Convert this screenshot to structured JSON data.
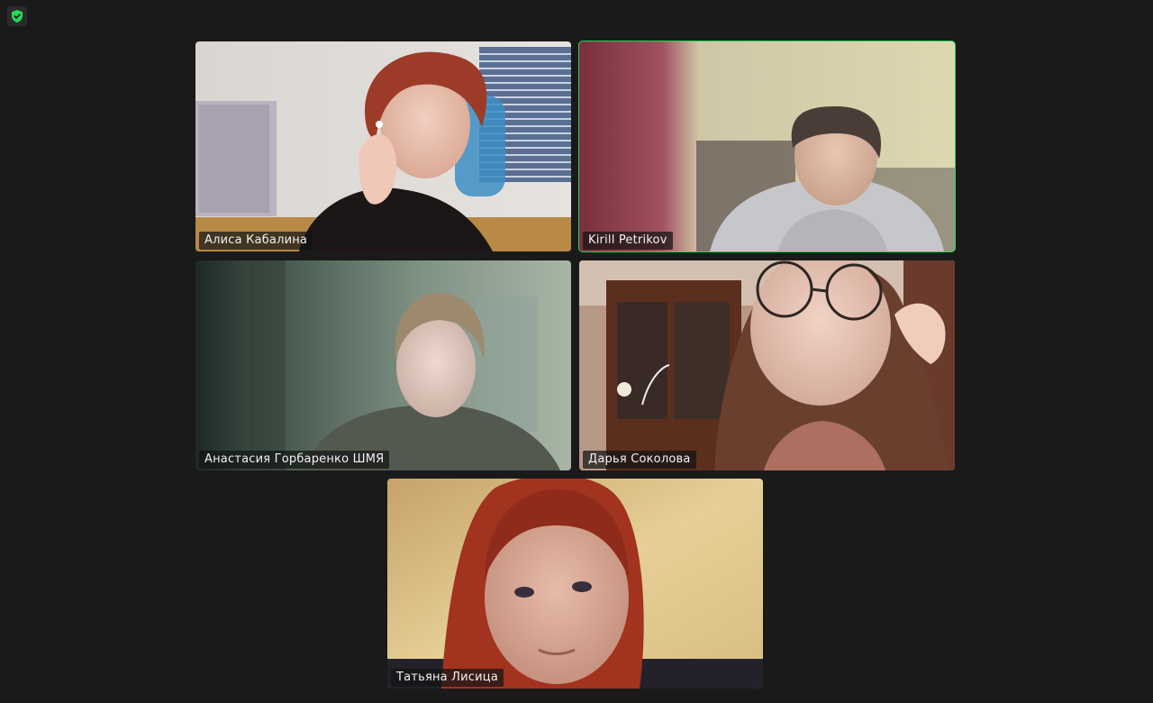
{
  "meeting": {
    "participants": [
      {
        "name": "Алиса Кабалина",
        "active_speaker": false
      },
      {
        "name": "Kirill Petrikov",
        "active_speaker": true
      },
      {
        "name": "Анастасия Горбаренко ШМЯ",
        "active_speaker": false
      },
      {
        "name": "Дарья Соколова",
        "active_speaker": false
      },
      {
        "name": "Татьяна Лисица",
        "active_speaker": false
      }
    ]
  },
  "colors": {
    "background": "#1a1a1a",
    "active_speaker_border": "#23d959",
    "security_icon": "#23d959"
  },
  "icons": {
    "security": "shield-check-icon"
  }
}
